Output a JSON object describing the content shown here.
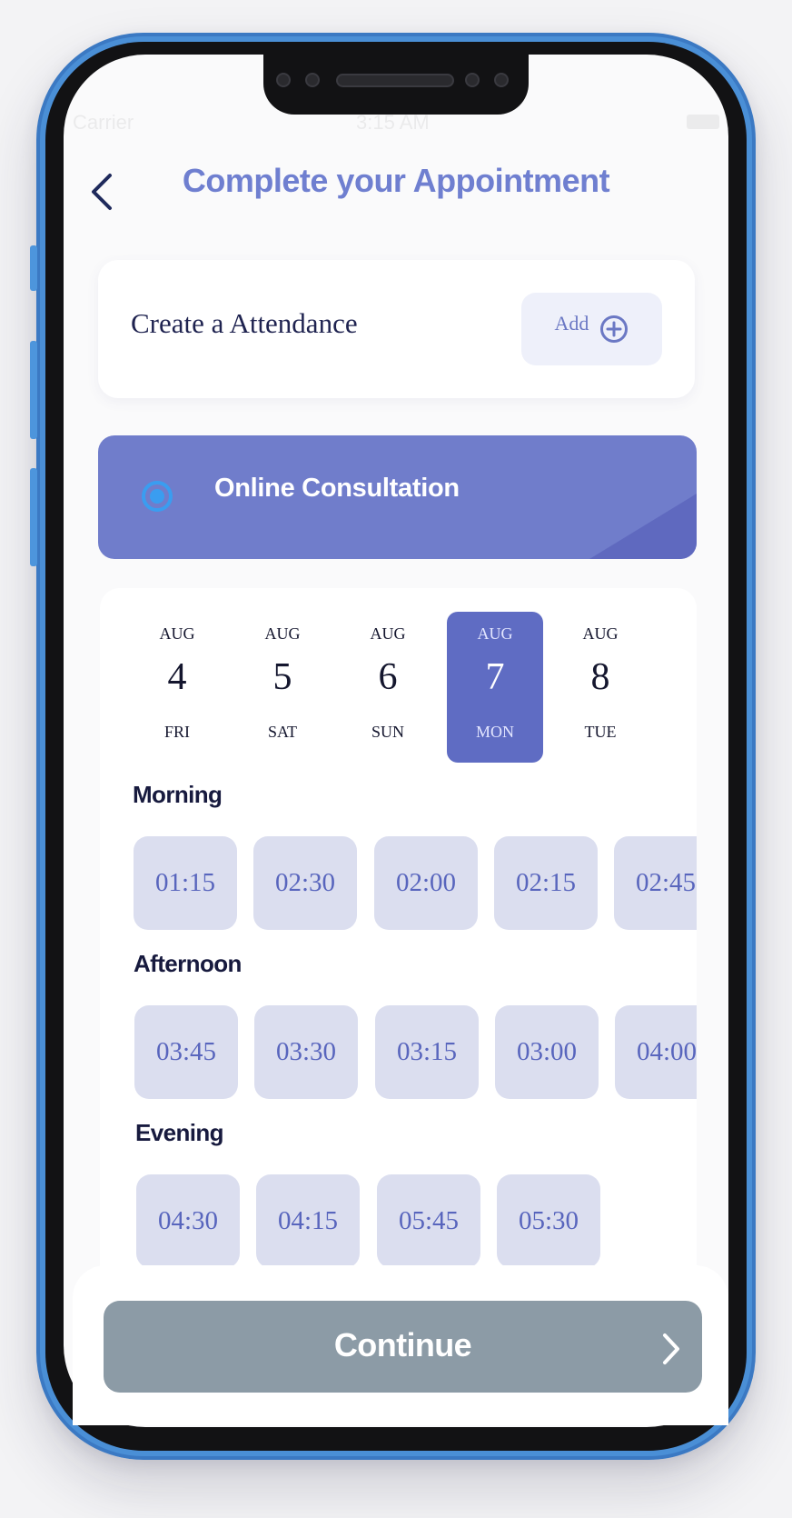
{
  "status_bar": {
    "carrier": "Carrier",
    "time": "3:15 AM"
  },
  "header": {
    "title": "Complete your Appointment"
  },
  "attendance": {
    "label": "Create a Attendance",
    "add_label": "Add"
  },
  "consultation": {
    "label": "Online Consultation"
  },
  "dates": [
    {
      "month": "AUG",
      "day": "4",
      "dow": "FRI"
    },
    {
      "month": "AUG",
      "day": "5",
      "dow": "SAT"
    },
    {
      "month": "AUG",
      "day": "6",
      "dow": "SUN"
    },
    {
      "month": "AUG",
      "day": "7",
      "dow": "MON",
      "selected": true
    },
    {
      "month": "AUG",
      "day": "8",
      "dow": "TUE"
    }
  ],
  "sections": {
    "morning": {
      "label": "Morning",
      "slots": [
        "01:15",
        "02:30",
        "02:00",
        "02:15",
        "02:45"
      ]
    },
    "afternoon": {
      "label": "Afternoon",
      "slots": [
        "03:45",
        "03:30",
        "03:15",
        "03:00",
        "04:00"
      ]
    },
    "evening": {
      "label": "Evening",
      "slots": [
        "04:30",
        "04:15",
        "05:45",
        "05:30"
      ]
    }
  },
  "footer": {
    "continue_label": "Continue"
  },
  "colors": {
    "accent": "#707dcb",
    "selected_date": "#5f6cc3",
    "slot_bg": "#dbdeef",
    "continue_bg": "#8c9ba6",
    "radio": "#3a9df0"
  },
  "icons": {
    "back": "chevron-left-icon",
    "add": "plus-circle-icon",
    "radio": "radio-selected-icon",
    "continue": "chevron-right-icon"
  }
}
